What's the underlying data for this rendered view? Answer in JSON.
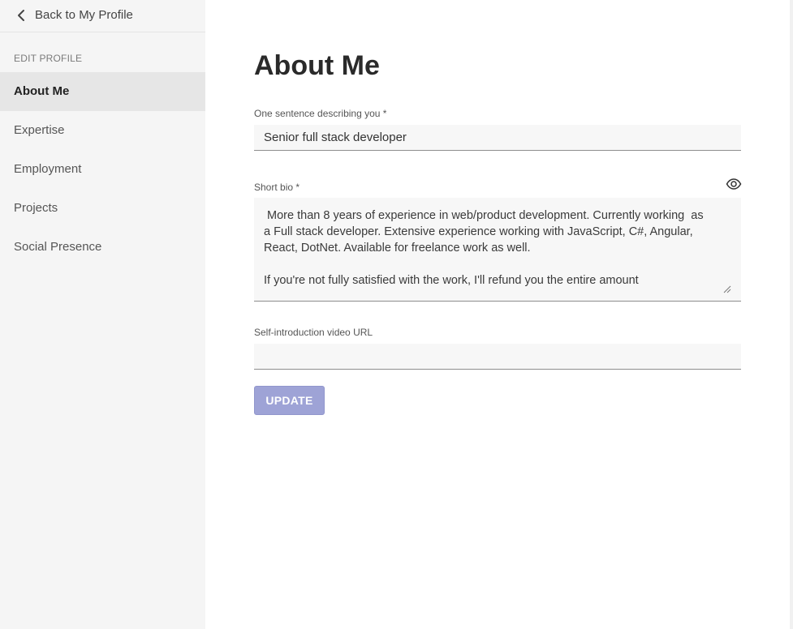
{
  "sidebar": {
    "back_label": "Back to My Profile",
    "section_heading": "EDIT PROFILE",
    "items": [
      {
        "label": "About Me",
        "active": true
      },
      {
        "label": "Expertise",
        "active": false
      },
      {
        "label": "Employment",
        "active": false
      },
      {
        "label": "Projects",
        "active": false
      },
      {
        "label": "Social Presence",
        "active": false
      }
    ]
  },
  "main": {
    "title": "About Me",
    "one_sentence": {
      "label": "One sentence describing you *",
      "value": "Senior full stack developer"
    },
    "short_bio": {
      "label": "Short bio *",
      "value": " More than 8 years of experience in web/product development. Currently working  as\na Full stack developer. Extensive experience working with JavaScript, C#, Angular,\nReact, DotNet. Available for freelance work as well.\n\nIf you're not fully satisfied with the work, I'll refund you the entire amount",
      "preview_icon": "eye-icon"
    },
    "video_url": {
      "label": "Self-introduction video URL",
      "value": ""
    },
    "update_label": "UPDATE"
  },
  "colors": {
    "sidebar_bg": "#f5f5f5",
    "active_item_bg": "#e6e6e6",
    "button_bg": "#9ea3d6",
    "field_bg": "#f7f7f7"
  }
}
